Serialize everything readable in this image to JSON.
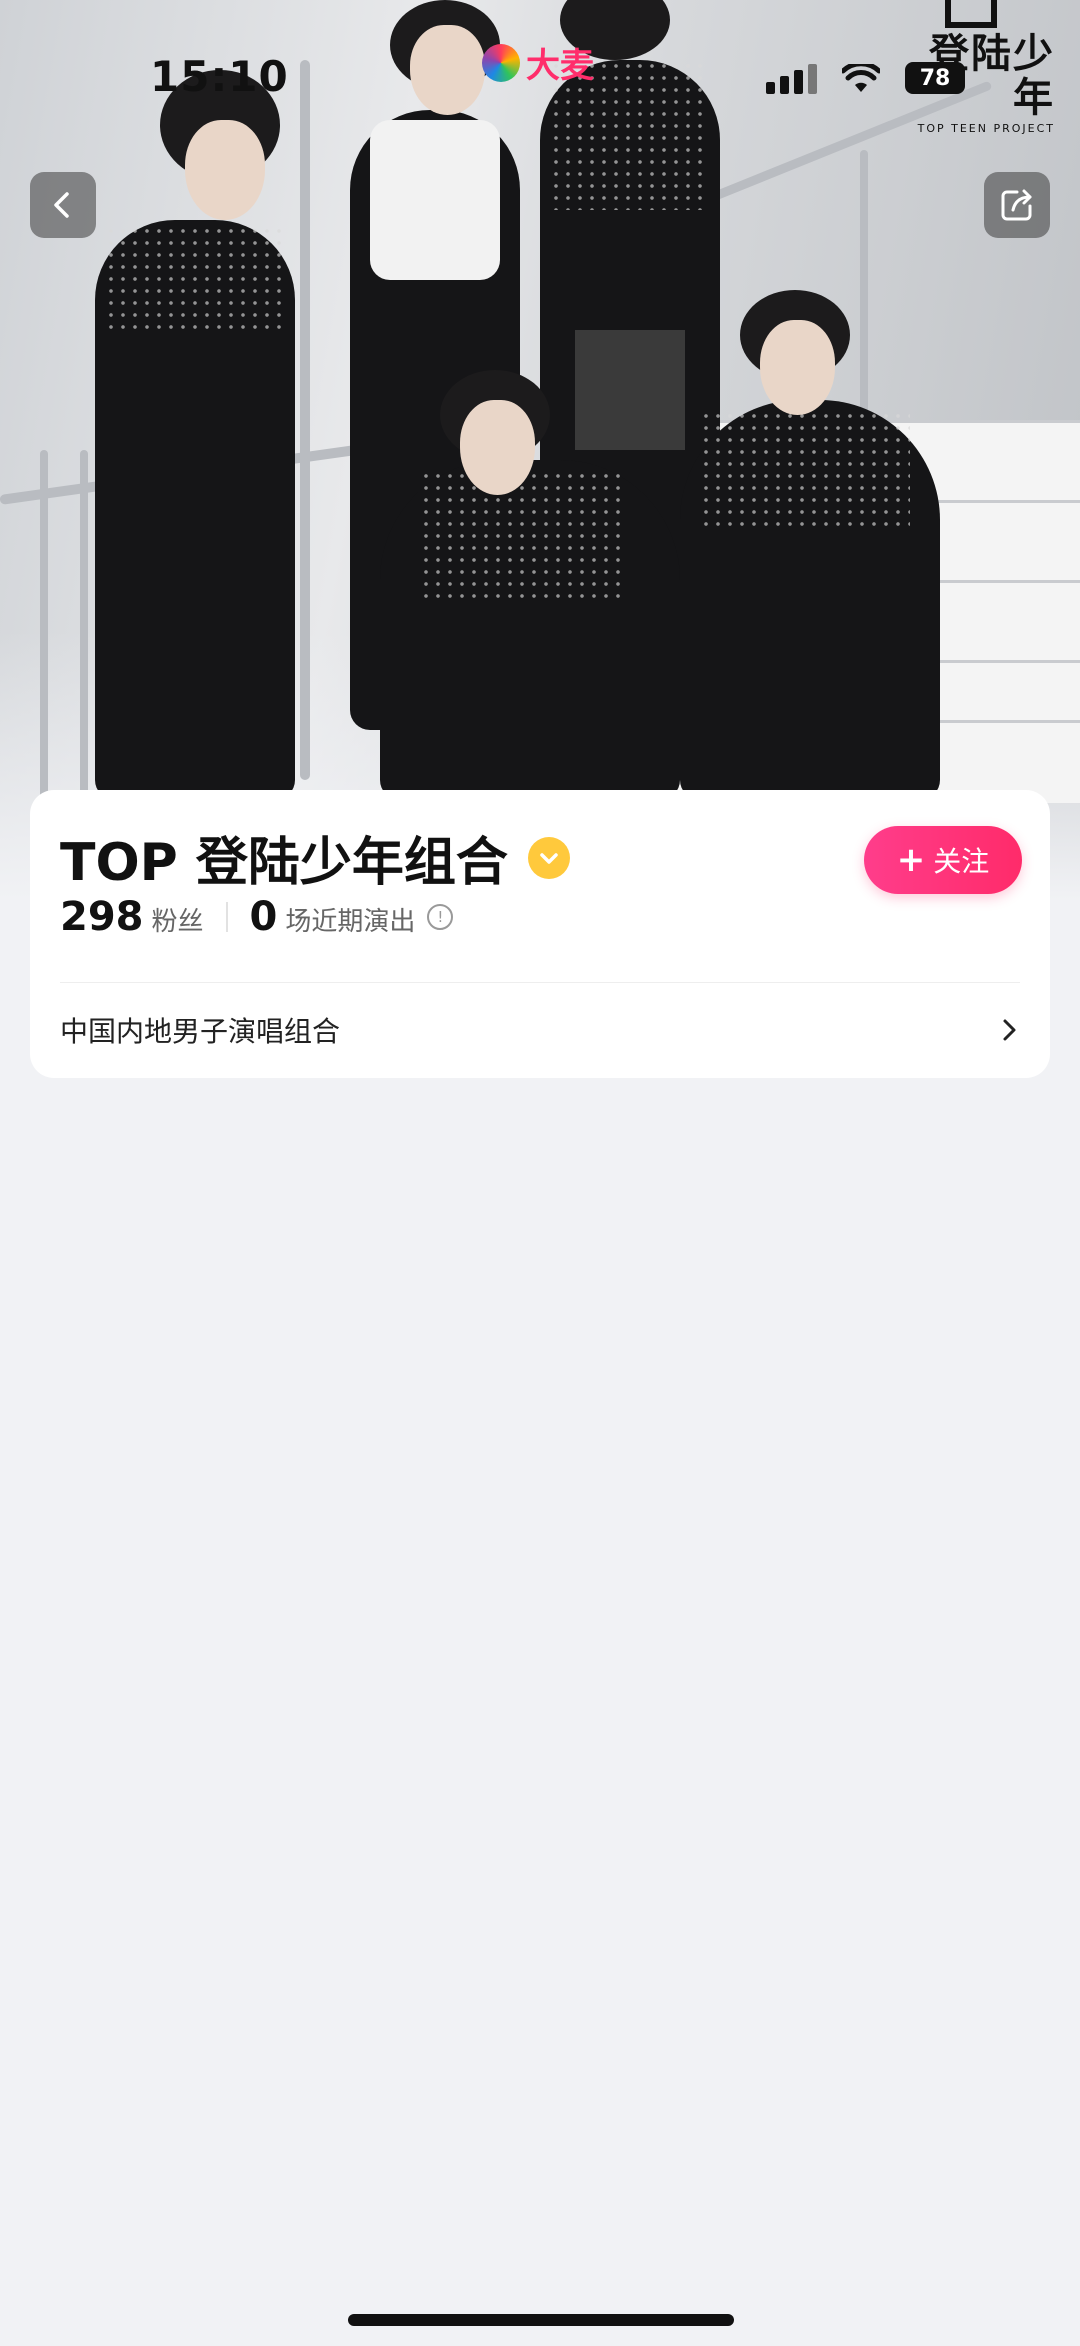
{
  "status_bar": {
    "time": "15:10",
    "app_name": "大麦",
    "battery": "78"
  },
  "hero": {
    "brand_logo_cn": "登陆少年",
    "brand_logo_en": "TOP TEEN PROJECT",
    "back_icon": "chevron-left-icon",
    "share_icon": "share-icon"
  },
  "artist": {
    "name": "TOP 登陆少年组合",
    "verified_icon": "verified-badge-icon",
    "follow_label": "关注",
    "fans_count": "298",
    "fans_label": "粉丝",
    "shows_count": "0",
    "shows_label": "场近期演出",
    "description": "中国内地男子演唱组合"
  },
  "colors": {
    "accent": "#ff2b6a",
    "verified": "#ffc93c",
    "background": "#f1f2f5"
  }
}
